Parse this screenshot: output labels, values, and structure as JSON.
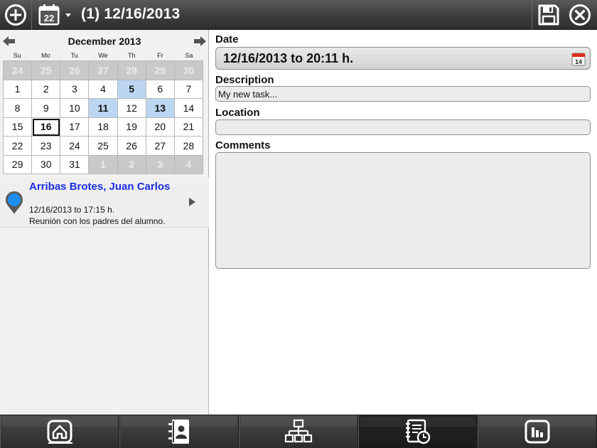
{
  "header": {
    "title": "(1) 12/16/2013",
    "calendar_icon_day": "22"
  },
  "calendar": {
    "month_label": "December 2013",
    "weekdays": [
      "Su",
      "Mo",
      "Tu",
      "We",
      "Th",
      "Fr",
      "Sa"
    ],
    "days": [
      {
        "d": "24",
        "other": true
      },
      {
        "d": "25",
        "other": true
      },
      {
        "d": "26",
        "other": true
      },
      {
        "d": "27",
        "other": true
      },
      {
        "d": "28",
        "other": true
      },
      {
        "d": "29",
        "other": true
      },
      {
        "d": "30",
        "other": true
      },
      {
        "d": "1"
      },
      {
        "d": "2"
      },
      {
        "d": "3"
      },
      {
        "d": "4"
      },
      {
        "d": "5",
        "has": true
      },
      {
        "d": "6"
      },
      {
        "d": "7"
      },
      {
        "d": "8"
      },
      {
        "d": "9"
      },
      {
        "d": "10"
      },
      {
        "d": "11",
        "has": true
      },
      {
        "d": "12"
      },
      {
        "d": "13",
        "has": true
      },
      {
        "d": "14"
      },
      {
        "d": "15"
      },
      {
        "d": "16",
        "today": true
      },
      {
        "d": "17"
      },
      {
        "d": "18"
      },
      {
        "d": "19"
      },
      {
        "d": "20"
      },
      {
        "d": "21"
      },
      {
        "d": "22"
      },
      {
        "d": "23"
      },
      {
        "d": "24"
      },
      {
        "d": "25"
      },
      {
        "d": "26"
      },
      {
        "d": "27"
      },
      {
        "d": "28"
      },
      {
        "d": "29"
      },
      {
        "d": "30"
      },
      {
        "d": "31"
      },
      {
        "d": "1",
        "other": true
      },
      {
        "d": "2",
        "other": true
      },
      {
        "d": "3",
        "other": true
      },
      {
        "d": "4",
        "other": true
      }
    ]
  },
  "event": {
    "name": "Arribas Brotes, Juan Carlos",
    "time": "12/16/2013 to 17:15 h.",
    "description": "Reunión con los padres del alumno."
  },
  "form": {
    "date_label": "Date",
    "date_value": "12/16/2013 to 20:11 h.",
    "date_icon_day": "14",
    "description_label": "Description",
    "description_value": "My new task...",
    "location_label": "Location",
    "location_value": "",
    "comments_label": "Comments",
    "comments_value": ""
  },
  "tabs": [
    {
      "icon": "home-icon",
      "active": false
    },
    {
      "icon": "contacts-icon",
      "active": false
    },
    {
      "icon": "hierarchy-icon",
      "active": false
    },
    {
      "icon": "task-history-icon",
      "active": true
    },
    {
      "icon": "chart-icon",
      "active": false
    }
  ],
  "colors": {
    "accent_blue": "#1b2ee3",
    "highlight_day": "#bcd6f2",
    "pin_blue": "#1e8ef0"
  }
}
